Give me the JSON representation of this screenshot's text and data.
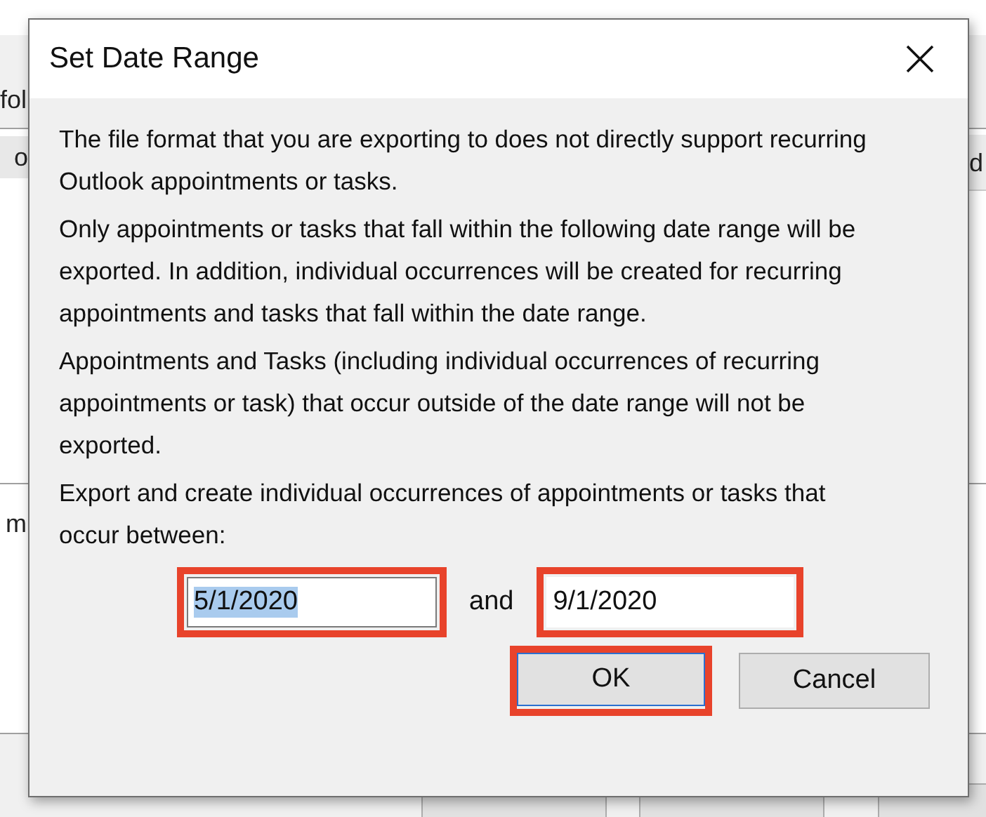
{
  "background_window": {
    "fragments": [
      {
        "kind": "label",
        "text": "fol"
      },
      {
        "kind": "row",
        "text": "o"
      },
      {
        "kind": "right",
        "text": "d"
      },
      {
        "kind": "label2",
        "text": "m"
      }
    ]
  },
  "dialog": {
    "title": "Set Date Range",
    "paragraphs": [
      "The file format that you are exporting to does not directly support recurring Outlook appointments or tasks.",
      "Only appointments or tasks that fall within the following date range will be exported.  In addition, individual occurrences will be created for recurring appointments and tasks that fall within the date range.",
      "Appointments and Tasks (including individual occurrences of recurring appointments or task) that occur outside of the date range will not be exported.",
      "Export and create individual occurrences of appointments or tasks that occur between:"
    ],
    "start_field": {
      "value": "5/1/2020",
      "text_selected": true,
      "highlighted": true
    },
    "connector": "and",
    "end_field": {
      "value": "9/1/2020",
      "text_selected": false,
      "highlighted": true
    },
    "buttons": [
      {
        "label": "OK",
        "default": true,
        "highlighted": true
      },
      {
        "label": "Cancel",
        "default": false,
        "highlighted": false
      }
    ]
  }
}
